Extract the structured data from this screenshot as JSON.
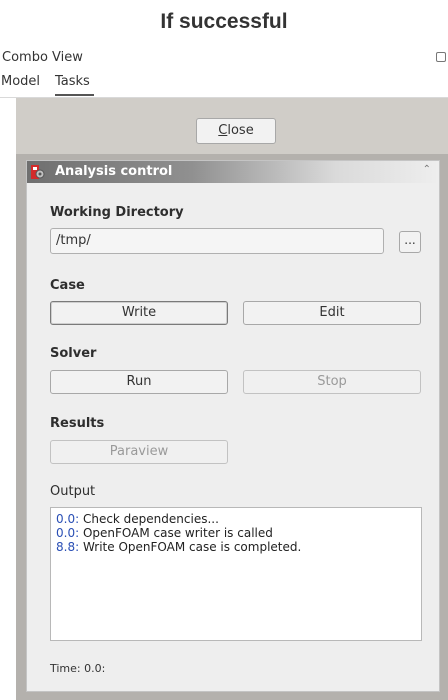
{
  "caption": "If successful",
  "window": {
    "title": "Combo View"
  },
  "tabs": [
    {
      "label": "Model",
      "active": false
    },
    {
      "label": "Tasks",
      "active": true
    }
  ],
  "toolbar": {
    "close_label": "Close",
    "close_mnemonic": "C",
    "close_rest": "lose"
  },
  "panel": {
    "title": "Analysis control",
    "working_directory": {
      "label": "Working Directory",
      "value": "/tmp/",
      "browse_label": "..."
    },
    "case": {
      "label": "Case",
      "write_label": "Write",
      "edit_label": "Edit"
    },
    "solver": {
      "label": "Solver",
      "run_label": "Run",
      "stop_label": "Stop"
    },
    "results": {
      "label": "Results",
      "paraview_label": "Paraview"
    },
    "output": {
      "label": "Output",
      "lines": [
        {
          "time": "0.0:",
          "text": " Check dependencies..."
        },
        {
          "time": "0.0:",
          "text": " OpenFOAM case writer is called"
        },
        {
          "time": "8.8:",
          "text": " Write OpenFOAM case is completed."
        }
      ]
    },
    "time_label": "Time: 0.0:"
  },
  "colors": {
    "log_time": "#2a4fb5",
    "pane_background": "#b4b1ad",
    "header_gradient_start": "#6f6f6f"
  }
}
